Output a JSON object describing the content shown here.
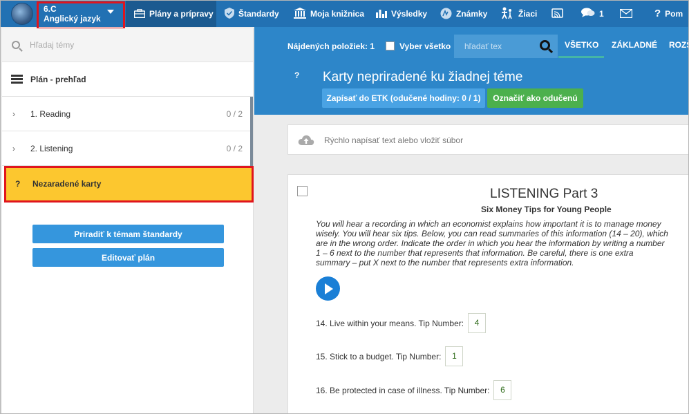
{
  "class_selector": {
    "line1": "6.C",
    "line2": "Anglický jazyk"
  },
  "nav": {
    "plans": "Plány a prípravy",
    "standards": "Štandardy",
    "library": "Moja knižnica",
    "results": "Výsledky",
    "grades": "Známky",
    "students": "Žiaci",
    "messages_count": "1",
    "help": "Pom"
  },
  "left": {
    "search_placeholder": "Hľadaj témy",
    "overview": "Plán - prehľad",
    "topics": [
      {
        "label": "1. Reading",
        "count": "0 / 2"
      },
      {
        "label": "2. Listening",
        "count": "0 / 2"
      }
    ],
    "unassigned_q": "?",
    "unassigned": "Nezaradené karty",
    "assign_button": "Priradiť k témam štandardy",
    "edit_button": "Editovať plán"
  },
  "toolbar": {
    "found": "Nájdených položiek: 1",
    "select_all": "Vyber všetko",
    "search_placeholder": "hľadať tex",
    "tab_all": "VŠETKO",
    "tab_basic": "ZÁKLADNÉ",
    "tab_ext": "ROZŠ"
  },
  "header": {
    "q": "?",
    "title": "Karty nepriradené ku žiadnej téme",
    "etk_button": "Zapísať do ETK (odučené hodiny: 0 / 1)",
    "mark_button": "Označiť ako odučenú"
  },
  "quick_text": "Rýchlo napísať text alebo vložiť súbor",
  "card": {
    "title": "LISTENING Part 3",
    "subtitle": "Six Money Tips for Young People",
    "instructions": "You will hear a recording in which an economist explains how important it is to manage money wisely. You will hear six tips. Below, you can read summaries of this information (14 – 20), which are in the wrong order. Indicate the order in which you hear the information by writing a number 1 – 6 next to the number that represents that information. Be careful, there is one extra summary – put X next to the number that represents extra information.",
    "questions": [
      {
        "text": "14. Live within your means. Tip Number:",
        "answer": "4"
      },
      {
        "text": "15. Stick to a budget. Tip Number:",
        "answer": "1"
      },
      {
        "text": "16. Be protected in case of illness. Tip Number:",
        "answer": "6"
      }
    ]
  },
  "colors": {
    "nav_bg": "#2271b3",
    "panel_blue": "#2d86c9",
    "button_blue": "#3596dd",
    "green": "#4cb04d",
    "yellow": "#fcc72f",
    "highlight_red": "#e0151d"
  }
}
